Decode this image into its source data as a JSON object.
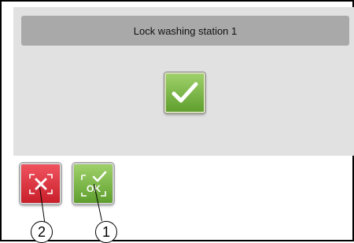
{
  "dialog": {
    "title": "Lock washing station 1",
    "confirm_icon": "checkmark-icon"
  },
  "toolbar": {
    "cancel_icon": "cancel-x-icon",
    "ok_label": "OK",
    "ok_icon": "ok-check-icon"
  },
  "callouts": [
    {
      "label": "2"
    },
    {
      "label": "1"
    }
  ],
  "colors": {
    "panel": "#e1e1e1",
    "title_bar": "#a9a9a9",
    "ok_green": "#6fb13a",
    "cancel_red": "#d9323d"
  }
}
